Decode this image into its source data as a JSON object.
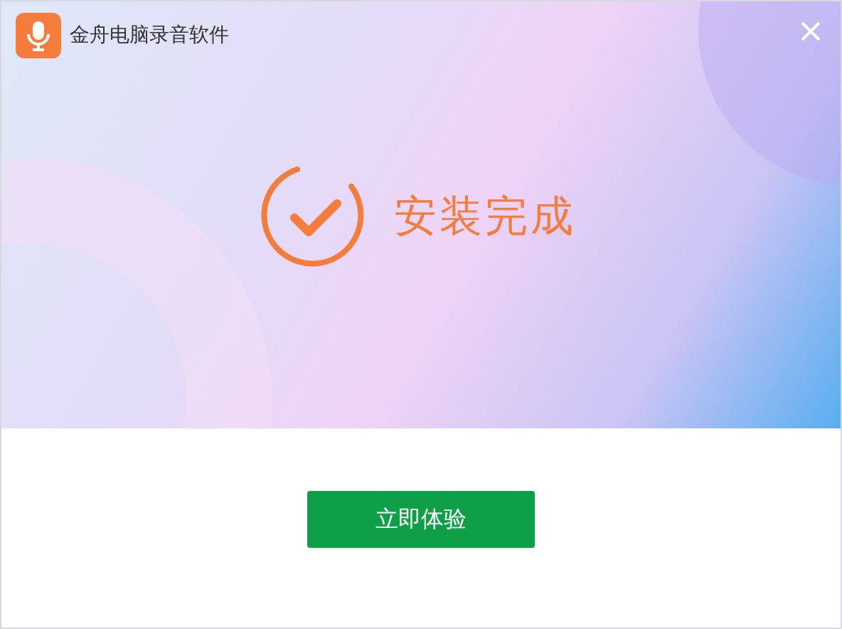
{
  "window": {
    "title": "金舟电脑录音软件"
  },
  "status": {
    "message": "安装完成"
  },
  "buttons": [
    {
      "label": "立即体验"
    }
  ]
}
